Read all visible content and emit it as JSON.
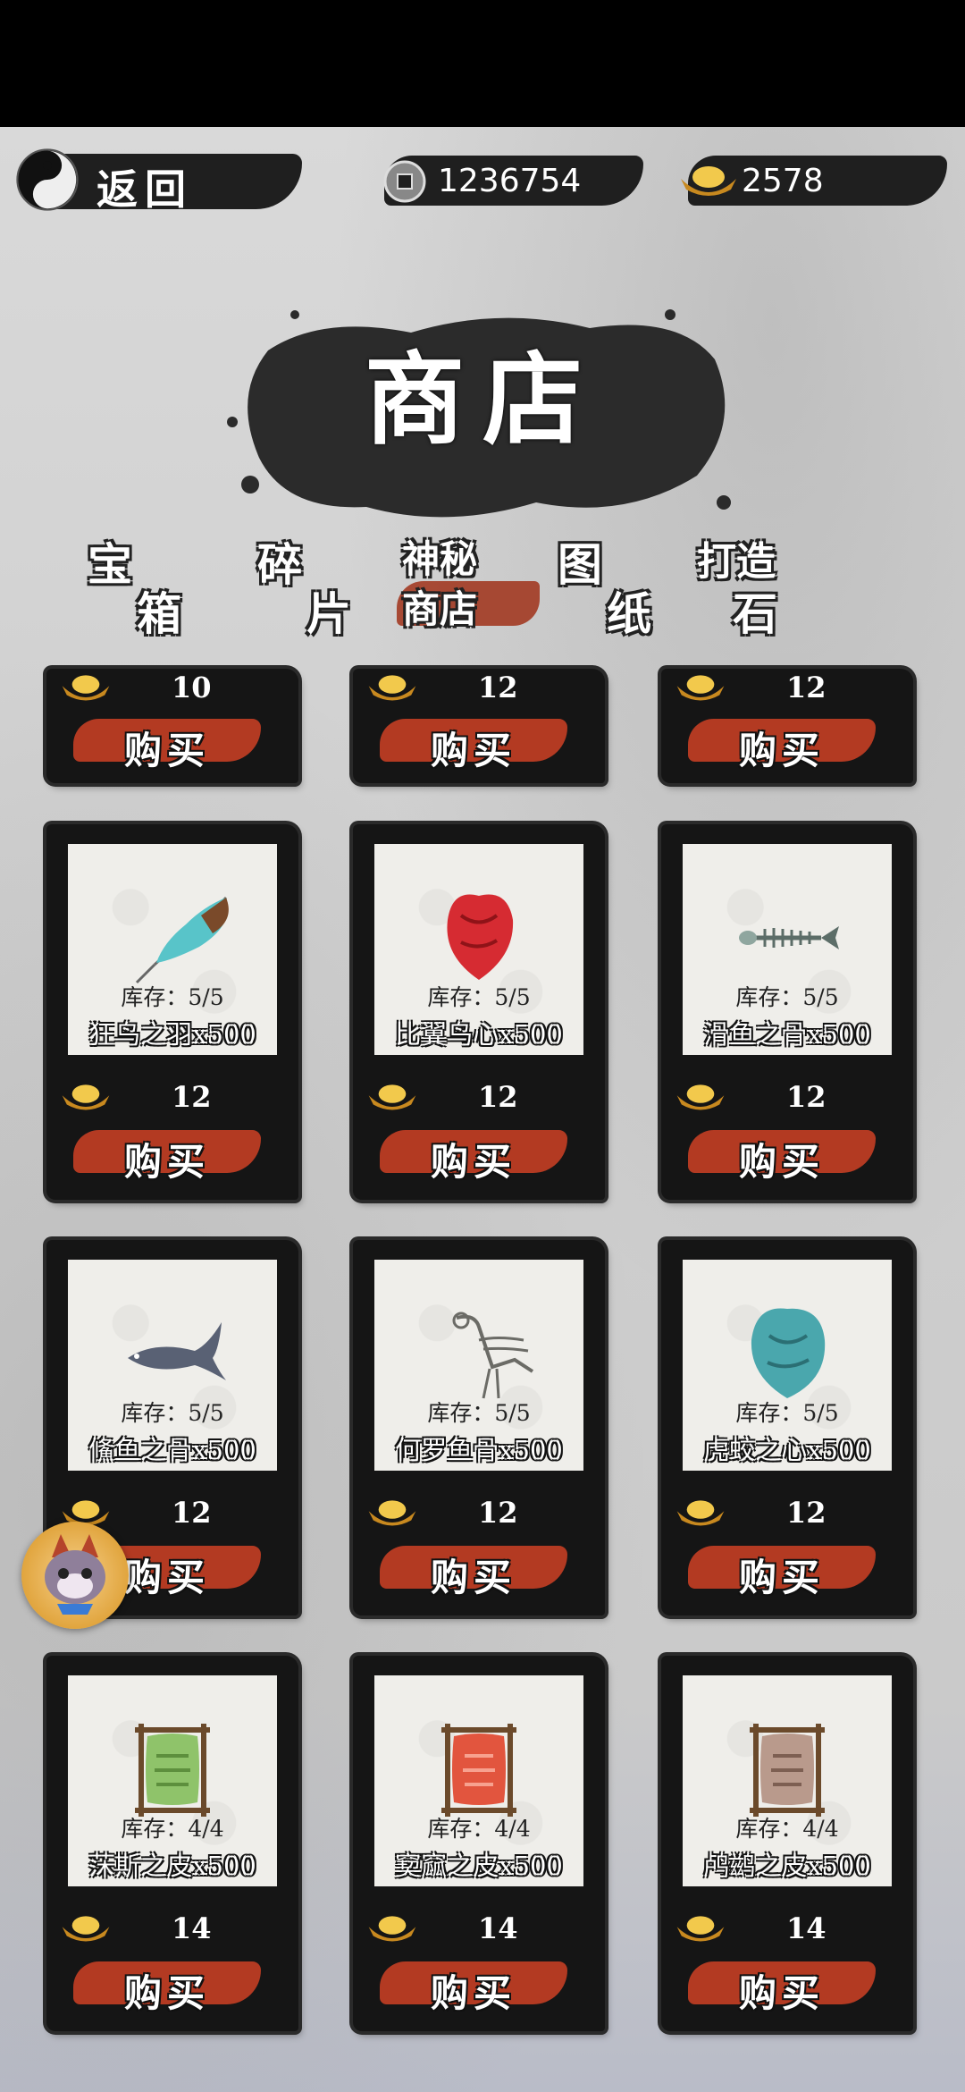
{
  "header": {
    "back_label": "返回",
    "coins": "1236754",
    "gold": "2578"
  },
  "title": "商店",
  "tabs": [
    {
      "line1": "宝",
      "line2": "箱",
      "active": false
    },
    {
      "line1": "碎",
      "line2": "片",
      "active": false
    },
    {
      "line1": "神秘",
      "line2": "商店",
      "active": true
    },
    {
      "line1": "图",
      "line2": "纸",
      "active": false
    },
    {
      "line1": "打造",
      "line2": "石",
      "active": false
    }
  ],
  "buy_label": "购买",
  "partial_row": [
    {
      "price": "10"
    },
    {
      "price": "12"
    },
    {
      "price": "12"
    }
  ],
  "items": [
    {
      "name": "狂鸟之羽x500",
      "stock": "库存：5/5",
      "price": "12",
      "icon": "feather-icon"
    },
    {
      "name": "比翼鸟心x500",
      "stock": "库存：5/5",
      "price": "12",
      "icon": "red-heart-icon"
    },
    {
      "name": "滑鱼之骨x500",
      "stock": "库存：5/5",
      "price": "12",
      "icon": "fish-bone-icon"
    },
    {
      "name": "鯈鱼之骨x500",
      "stock": "库存：5/5",
      "price": "12",
      "icon": "fish-icon"
    },
    {
      "name": "何罗鱼骨x500",
      "stock": "库存：5/5",
      "price": "12",
      "icon": "bird-skeleton-icon"
    },
    {
      "name": "虎蛟之心x500",
      "stock": "库存：5/5",
      "price": "12",
      "icon": "teal-heart-icon"
    },
    {
      "name": "莯斯之皮x500",
      "stock": "库存：4/4",
      "price": "14",
      "icon": "green-hide-icon"
    },
    {
      "name": "窫窳之皮x500",
      "stock": "库存：4/4",
      "price": "14",
      "icon": "red-hide-icon"
    },
    {
      "name": "鸬鹚之皮x500",
      "stock": "库存：4/4",
      "price": "14",
      "icon": "brown-hide-icon"
    }
  ],
  "colors": {
    "buy_smear": "#b33a22",
    "card_bg": "#151515",
    "gold": "#d9a531"
  }
}
